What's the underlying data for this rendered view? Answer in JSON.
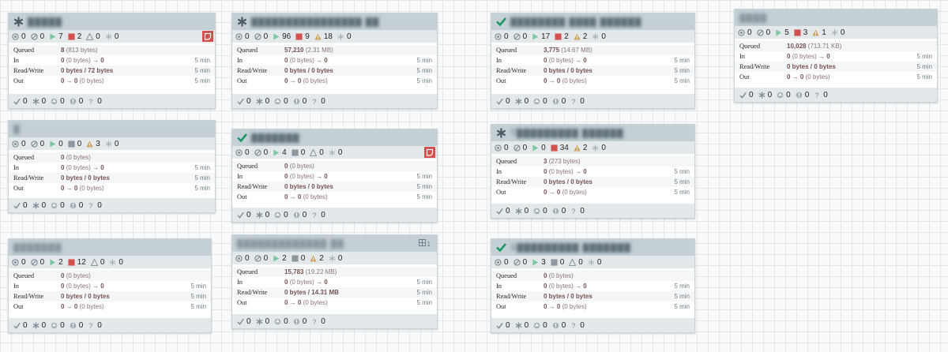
{
  "colors": {
    "header": "#c4d0d6",
    "bar": "#e3e8eb",
    "running": "#7dc7a0",
    "stopped": "#d3504d",
    "warning": "#cf9f5d",
    "invalid_green": "#1a9964",
    "value": "#775351"
  },
  "groups": [
    {
      "name": "█████",
      "state_icon": "asterisk-icon",
      "badge": "",
      "comment": true,
      "stats": {
        "transmitting": "0",
        "not_transmitting": "0",
        "running": "7",
        "stopped": "2",
        "invalid": "0",
        "disabled": "0"
      },
      "queued": {
        "count": "8",
        "size": "(813 bytes)"
      },
      "in": {
        "val": "0",
        "size": "(0 bytes)",
        "arrow": "→ 0",
        "time": "5 min"
      },
      "rw": {
        "val": "0 bytes / 72 bytes",
        "time": "5 min"
      },
      "out": {
        "val": "0 → 0",
        "size": "(0 bytes)",
        "time": "5 min"
      },
      "footer": {
        "up_to_date": "0",
        "locally_modified": "0",
        "stale": "0",
        "modified_stale": "0",
        "sync_failure": "0"
      }
    },
    {
      "name": "████████████████ ██",
      "state_icon": "asterisk-icon",
      "badge": "",
      "comment": false,
      "stats": {
        "transmitting": "0",
        "not_transmitting": "0",
        "running": "96",
        "stopped": "9",
        "invalid": "18",
        "disabled": "0"
      },
      "queued": {
        "count": "57,210",
        "size": "(2.31 MB)"
      },
      "in": {
        "val": "0",
        "size": "(0 bytes)",
        "arrow": "→ 0",
        "time": "5 min"
      },
      "rw": {
        "val": "0 bytes / 0 bytes",
        "time": "5 min"
      },
      "out": {
        "val": "0 → 0",
        "size": "(0 bytes)",
        "time": "5 min"
      },
      "footer": {
        "up_to_date": "0",
        "locally_modified": "0",
        "stale": "0",
        "modified_stale": "0",
        "sync_failure": "0"
      }
    },
    {
      "name": "████████ ████ ██████",
      "state_icon": "checkmark-icon",
      "badge": "",
      "comment": false,
      "stats": {
        "transmitting": "0",
        "not_transmitting": "0",
        "running": "17",
        "stopped": "2",
        "invalid": "2",
        "disabled": "0"
      },
      "queued": {
        "count": "3,775",
        "size": "(14.67 MB)"
      },
      "in": {
        "val": "0",
        "size": "(0 bytes)",
        "arrow": "→ 0",
        "time": "5 min"
      },
      "rw": {
        "val": "0 bytes / 0 bytes",
        "time": "5 min"
      },
      "out": {
        "val": "0 → 0",
        "size": "(0 bytes)",
        "time": "5 min"
      },
      "footer": {
        "up_to_date": "0",
        "locally_modified": "0",
        "stale": "0",
        "modified_stale": "0",
        "sync_failure": "0"
      }
    },
    {
      "name": "████",
      "state_icon": "",
      "badge": "",
      "comment": false,
      "stats": {
        "transmitting": "0",
        "not_transmitting": "0",
        "running": "5",
        "stopped": "3",
        "invalid": "1",
        "disabled": "0"
      },
      "queued": {
        "count": "10,028",
        "size": "(713.71 KB)"
      },
      "in": {
        "val": "0",
        "size": "(0 bytes)",
        "arrow": "→ 0",
        "time": "5 min"
      },
      "rw": {
        "val": "0 bytes / 0 bytes",
        "time": "5 min"
      },
      "out": {
        "val": "0 → 0",
        "size": "(0 bytes)",
        "time": "5 min"
      },
      "footer": {
        "up_to_date": "0",
        "locally_modified": "0",
        "stale": "0",
        "modified_stale": "0",
        "sync_failure": "0"
      }
    },
    {
      "name": "█",
      "state_icon": "",
      "badge": "",
      "comment": false,
      "stats": {
        "transmitting": "0",
        "not_transmitting": "0",
        "running": "0",
        "stopped": "0",
        "invalid": "3",
        "disabled": "0"
      },
      "queued": {
        "count": "0",
        "size": "(0 bytes)"
      },
      "in": {
        "val": "0",
        "size": "(0 bytes)",
        "arrow": "→ 0",
        "time": "5 min"
      },
      "rw": {
        "val": "0 bytes / 0 bytes",
        "time": "5 min"
      },
      "out": {
        "val": "0 → 0",
        "size": "(0 bytes)",
        "time": "5 min"
      },
      "footer": {
        "up_to_date": "0",
        "locally_modified": "0",
        "stale": "0",
        "modified_stale": "0",
        "sync_failure": "0"
      }
    },
    {
      "name": "███████",
      "state_icon": "checkmark-icon",
      "badge": "",
      "comment": true,
      "stats": {
        "transmitting": "0",
        "not_transmitting": "0",
        "running": "4",
        "stopped": "0",
        "invalid": "0",
        "disabled": "0"
      },
      "queued": {
        "count": "0",
        "size": "(0 bytes)"
      },
      "in": {
        "val": "0",
        "size": "(0 bytes)",
        "arrow": "→ 0",
        "time": "5 min"
      },
      "rw": {
        "val": "0 bytes / 0 bytes",
        "time": "5 min"
      },
      "out": {
        "val": "0 → 0",
        "size": "(0 bytes)",
        "time": "5 min"
      },
      "footer": {
        "up_to_date": "0",
        "locally_modified": "0",
        "stale": "0",
        "modified_stale": "0",
        "sync_failure": "0"
      }
    },
    {
      "name": "T█████████ ██████",
      "state_icon": "asterisk-icon",
      "badge": "",
      "comment": false,
      "stats": {
        "transmitting": "0",
        "not_transmitting": "0",
        "running": "0",
        "stopped": "34",
        "invalid": "2",
        "disabled": "0"
      },
      "queued": {
        "count": "3",
        "size": "(273 bytes)"
      },
      "in": {
        "val": "0",
        "size": "(0 bytes)",
        "arrow": "→ 0",
        "time": "5 min"
      },
      "rw": {
        "val": "0 bytes / 0 bytes",
        "time": "5 min"
      },
      "out": {
        "val": "0 → 0",
        "size": "(0 bytes)",
        "time": "5 min"
      },
      "footer": {
        "up_to_date": "0",
        "locally_modified": "0",
        "stale": "0",
        "modified_stale": "0",
        "sync_failure": "0"
      }
    },
    {
      "name": "███████",
      "state_icon": "",
      "badge": "",
      "comment": false,
      "stats": {
        "transmitting": "0",
        "not_transmitting": "0",
        "running": "2",
        "stopped": "12",
        "invalid": "0",
        "disabled": "0"
      },
      "queued": {
        "count": "0",
        "size": "(0 bytes)"
      },
      "in": {
        "val": "0",
        "size": "(0 bytes)",
        "arrow": "→ 0",
        "time": "5 min"
      },
      "rw": {
        "val": "0 bytes / 0 bytes",
        "time": "5 min"
      },
      "out": {
        "val": "0 → 0",
        "size": "(0 bytes)",
        "time": "5 min"
      },
      "footer": {
        "up_to_date": "0",
        "locally_modified": "0",
        "stale": "0",
        "modified_stale": "0",
        "sync_failure": "0"
      }
    },
    {
      "name": "█████████████ ██",
      "state_icon": "",
      "badge": "1",
      "comment": false,
      "stats": {
        "transmitting": "0",
        "not_transmitting": "0",
        "running": "2",
        "stopped": "0",
        "invalid": "2",
        "disabled": "0"
      },
      "queued": {
        "count": "15,783",
        "size": "(19.22 MB)"
      },
      "in": {
        "val": "0",
        "size": "(0 bytes)",
        "arrow": "→ 0",
        "time": "5 min"
      },
      "rw": {
        "val": "0 bytes / 14.31 MB",
        "time": "5 min"
      },
      "out": {
        "val": "0 → 0",
        "size": "(0 bytes)",
        "time": "5 min"
      },
      "footer": {
        "up_to_date": "0",
        "locally_modified": "0",
        "stale": "0",
        "modified_stale": "0",
        "sync_failure": "0"
      }
    },
    {
      "name": "S█████████ ███████",
      "state_icon": "checkmark-icon",
      "badge": "",
      "comment": false,
      "stats": {
        "transmitting": "0",
        "not_transmitting": "0",
        "running": "3",
        "stopped": "0",
        "invalid": "0",
        "disabled": "0"
      },
      "queued": {
        "count": "0",
        "size": "(0 bytes)"
      },
      "in": {
        "val": "0",
        "size": "(0 bytes)",
        "arrow": "→ 0",
        "time": "5 min"
      },
      "rw": {
        "val": "0 bytes / 0 bytes",
        "time": "5 min"
      },
      "out": {
        "val": "0 → 0",
        "size": "(0 bytes)",
        "time": "5 min"
      },
      "footer": {
        "up_to_date": "0",
        "locally_modified": "0",
        "stale": "0",
        "modified_stale": "0",
        "sync_failure": "0"
      }
    }
  ],
  "labels": {
    "queued": "Queued",
    "in": "In",
    "rw": "Read/Write",
    "out": "Out"
  }
}
